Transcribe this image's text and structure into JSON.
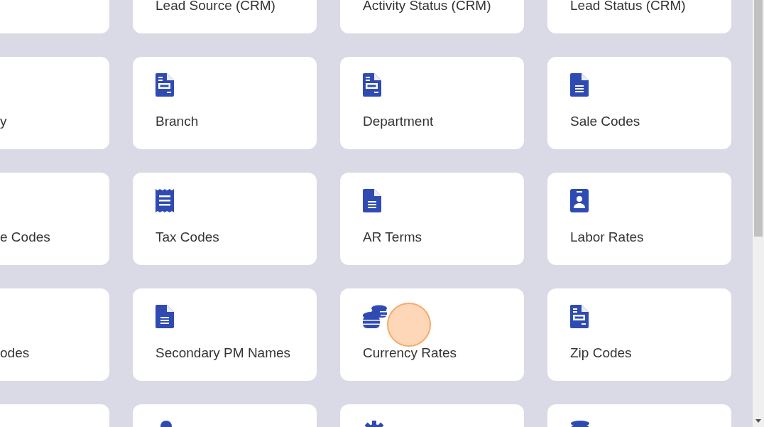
{
  "rows": [
    {
      "cards": [
        {
          "kind": "blank"
        },
        {
          "kind": "blank",
          "label": "Lead Source (CRM)"
        },
        {
          "kind": "blank",
          "label": "Activity Status (CRM)"
        },
        {
          "kind": "blank",
          "label": "Lead Status (CRM)"
        }
      ]
    },
    {
      "cards": [
        {
          "kind": "blank",
          "label": "y"
        },
        {
          "kind": "form",
          "label": "Branch"
        },
        {
          "kind": "form",
          "label": "Department"
        },
        {
          "kind": "doc",
          "label": "Sale Codes"
        }
      ]
    },
    {
      "cards": [
        {
          "kind": "blank",
          "label": "e Codes"
        },
        {
          "kind": "receipt",
          "label": "Tax Codes"
        },
        {
          "kind": "doc",
          "label": "AR Terms"
        },
        {
          "kind": "badge",
          "label": "Labor Rates"
        }
      ]
    },
    {
      "cards": [
        {
          "kind": "blank",
          "label": "odes"
        },
        {
          "kind": "doc",
          "label": "Secondary PM Names"
        },
        {
          "kind": "coins",
          "label": "Currency Rates"
        },
        {
          "kind": "form",
          "label": "Zip Codes"
        }
      ]
    },
    {
      "cards": [
        {
          "kind": "blank"
        },
        {
          "kind": "person"
        },
        {
          "kind": "gear"
        },
        {
          "kind": "database"
        }
      ]
    }
  ]
}
